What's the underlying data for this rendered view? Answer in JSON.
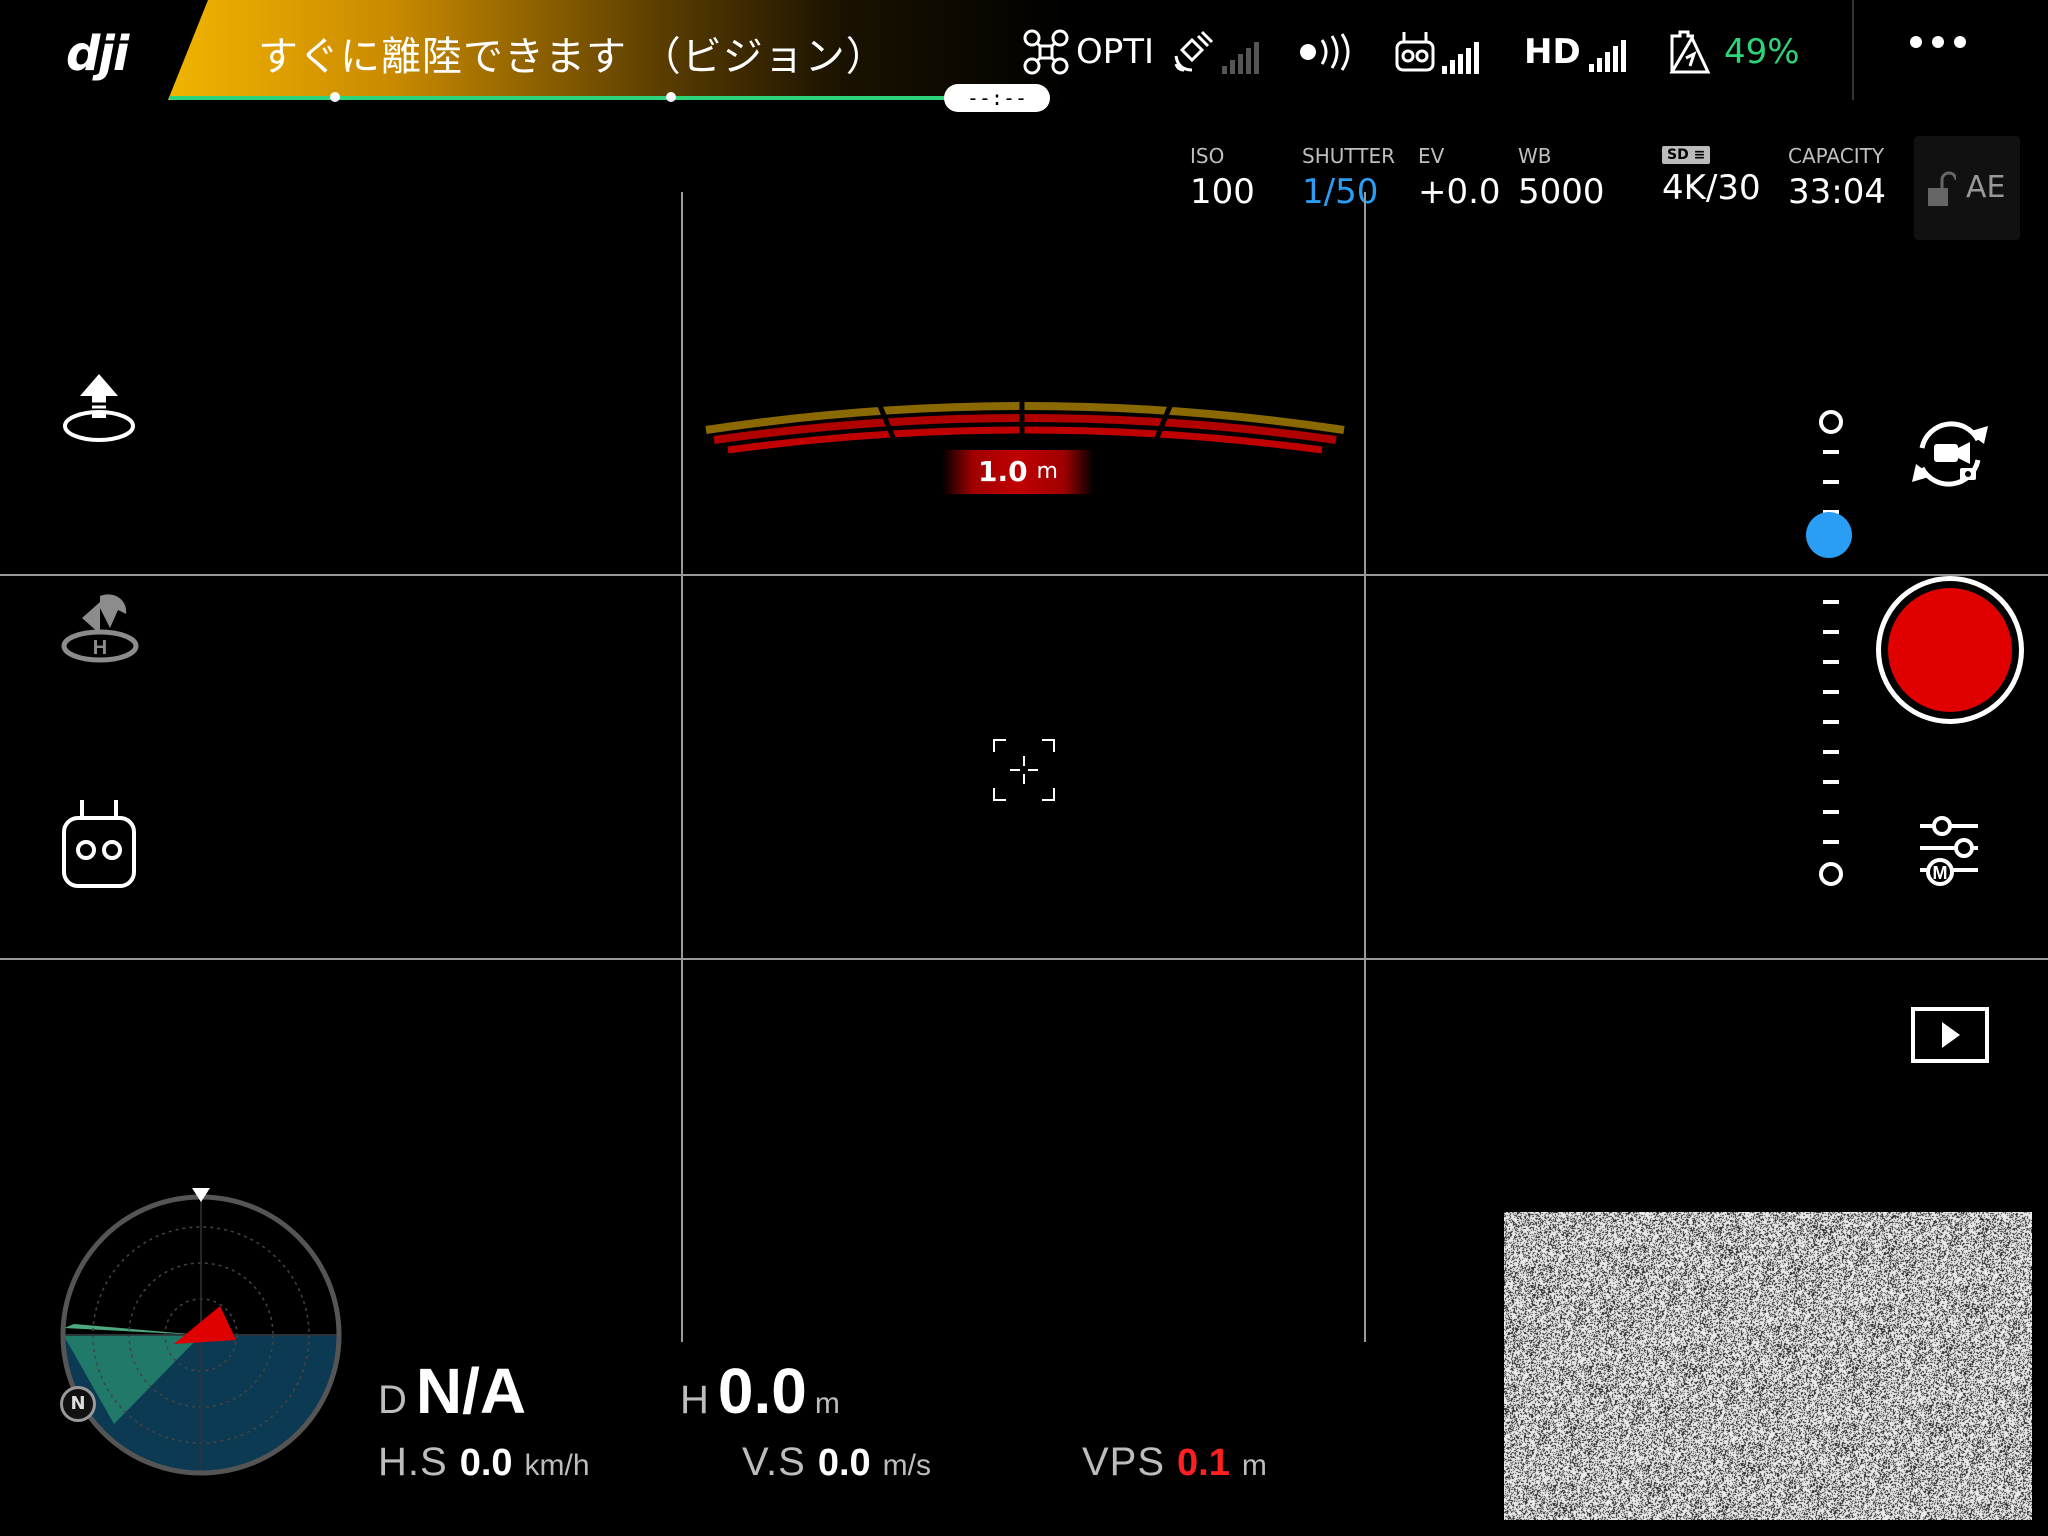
{
  "topbar": {
    "brand": "dji",
    "status_message": "すぐに離陸できます （ビジョン）",
    "flight_timer": "--:--",
    "flight_mode": "OPTI",
    "hd_label": "HD",
    "battery_percent": "49%",
    "more_label": "•••"
  },
  "camera": {
    "iso_label": "ISO",
    "iso_value": "100",
    "shutter_label": "SHUTTER",
    "shutter_value": "1/50",
    "ev_label": "EV",
    "ev_value": "+0.0",
    "wb_label": "WB",
    "wb_value": "5000",
    "sd_label": "SD",
    "resolution_value": "4K/30",
    "capacity_label": "CAPACITY",
    "capacity_value": "33:04",
    "ae_label": "AE"
  },
  "obstacle": {
    "distance_value": "1.0",
    "distance_unit": "m"
  },
  "compass": {
    "north_label": "N"
  },
  "telemetry": {
    "d_label": "D",
    "d_value": "N/A",
    "h_label": "H",
    "h_value": "0.0",
    "h_unit": "m",
    "hs_label": "H.S",
    "hs_value": "0.0",
    "hs_unit": "km/h",
    "vs_label": "V.S",
    "vs_value": "0.0",
    "vs_unit": "m/s",
    "vps_label": "VPS",
    "vps_value": "0.1",
    "vps_unit": "m"
  },
  "colors": {
    "accent_yellow": "#f2b400",
    "progress_green": "#2ed47a",
    "battery_green": "#2ed47a",
    "shutter_blue": "#2a9df4",
    "record_red": "#e00000",
    "vps_red": "#ff2020"
  }
}
